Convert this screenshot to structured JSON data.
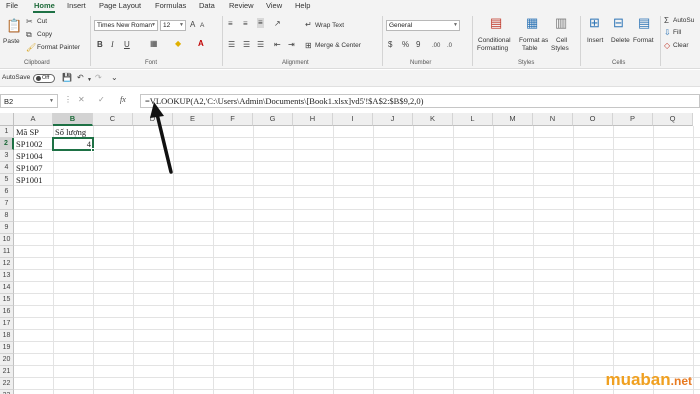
{
  "menu": {
    "tabs": [
      "File",
      "Home",
      "Insert",
      "Page Layout",
      "Formulas",
      "Data",
      "Review",
      "View",
      "Help"
    ],
    "active": "Home"
  },
  "ribbon": {
    "clipboard": {
      "paste": "Paste",
      "cut": "Cut",
      "copy": "Copy",
      "format_painter": "Format Painter",
      "label": "Clipboard"
    },
    "font": {
      "name": "Times New Roman",
      "size": "12",
      "label": "Font",
      "bold": "B",
      "italic": "I",
      "underline": "U"
    },
    "alignment": {
      "wrap_text": "Wrap Text",
      "merge_center": "Merge & Center",
      "label": "Alignment"
    },
    "number": {
      "format": "General",
      "label": "Number",
      "currency": "$",
      "percent": "%",
      "comma": "9"
    },
    "styles": {
      "conditional": "Conditional",
      "conditional2": "Formatting",
      "format_as": "Format as",
      "format_as2": "Table",
      "cell": "Cell",
      "cell2": "Styles",
      "label": "Styles"
    },
    "cells": {
      "insert": "Insert",
      "delete": "Delete",
      "format": "Format",
      "label": "Cells"
    },
    "editing": {
      "autosum": "AutoSu",
      "fill": "Fill",
      "clear": "Clear"
    }
  },
  "qat": {
    "autosave": "AutoSave",
    "toggle_state": "Off"
  },
  "formula_bar": {
    "name_box": "B2",
    "fx": "fx",
    "formula": "=VLOOKUP(A2,'C:\\Users\\Admin\\Documents\\[Book1.xlsx]vd5'!$A$2:$B$9,2,0)"
  },
  "sheet": {
    "columns": [
      "A",
      "B",
      "C",
      "D",
      "E",
      "F",
      "G",
      "H",
      "I",
      "J",
      "K",
      "L",
      "M",
      "N",
      "O",
      "P",
      "Q"
    ],
    "rows": [
      "1",
      "2",
      "3",
      "4",
      "5",
      "6",
      "7",
      "8",
      "9",
      "10",
      "11",
      "12",
      "13",
      "14",
      "15",
      "16",
      "17",
      "18",
      "19",
      "20",
      "21",
      "22",
      "23"
    ],
    "selected_column": "B",
    "selected_row": "2",
    "cells": {
      "A1": "Mã SP",
      "B1": "Số lượng",
      "A2": "SP1002",
      "B2": "4",
      "A3": "SP1004",
      "A4": "SP1007",
      "A5": "SP1001"
    }
  },
  "watermark": {
    "brand": "muaban",
    "tld": ".net"
  }
}
